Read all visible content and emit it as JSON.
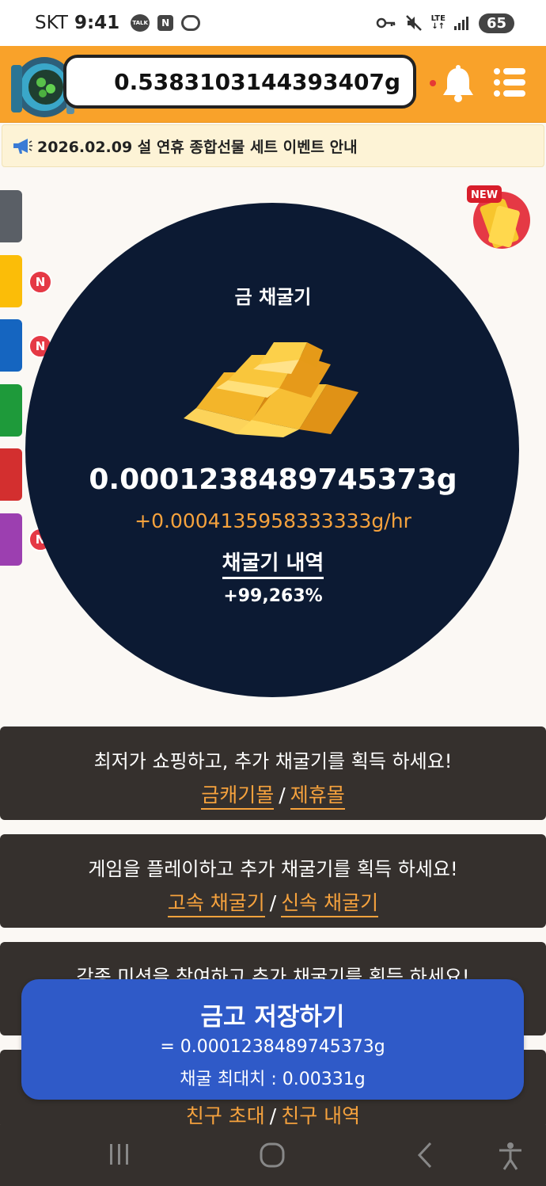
{
  "status_bar": {
    "carrier": "SKT",
    "time": "9:41",
    "talk": "TALK",
    "n_icon": "N",
    "lte": "LTE",
    "battery": "65"
  },
  "header": {
    "balance": "0.5383103144393407g"
  },
  "notice": {
    "text": "2026.02.09 설 연휴 종합선물 세트 이벤트 안내"
  },
  "side_tabs": {
    "badge": "N",
    "colors": [
      "#5a5f66",
      "#fbbd08",
      "#1565c0",
      "#1e9a3a",
      "#d32f2f",
      "#9c3fb0"
    ]
  },
  "new_gift": {
    "label": "NEW"
  },
  "miner": {
    "title": "금 채굴기",
    "amount": "0.0001238489745373g",
    "rate": "+0.0004135958333333g/hr",
    "history_label": "채굴기 내역",
    "percent": "+99,263%"
  },
  "promos": [
    {
      "text": "최저가 쇼핑하고, 추가 채굴기를 획득 하세요!",
      "link1": "금캐기몰",
      "sep": "/",
      "link2": "제휴몰"
    },
    {
      "text": "게임을 플레이하고 추가 채굴기를 획득 하세요!",
      "link1": "고속 채굴기",
      "sep": "/",
      "link2": "신속 채굴기"
    },
    {
      "text": "각종 미션을 참여하고 추가 채굴기를 획득 하세요!",
      "link1": "",
      "sep": "",
      "link2": ""
    },
    {
      "text": "",
      "link1": "친구 초대",
      "sep": "/",
      "link2": "친구 내역"
    }
  ],
  "save": {
    "title": "금고 저장하기",
    "amount": "= 0.0001238489745373g",
    "max": "채굴 최대치 : 0.00331g"
  },
  "colors": {
    "header": "#f9a22a",
    "circle": "#0c1a33",
    "accent": "#f6a23d",
    "save_button": "#2f5ac8"
  }
}
